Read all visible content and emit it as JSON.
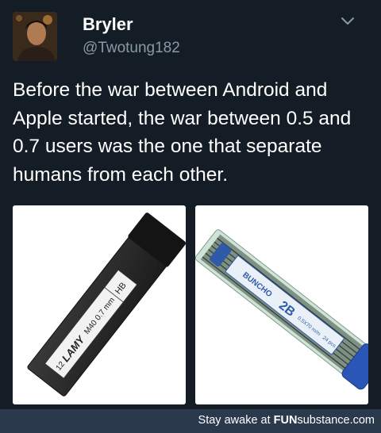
{
  "tweet": {
    "display_name": "Bryler",
    "handle": "@Twotung182",
    "text": "Before the war between Android and Apple started, the war between 0.5 and 0.7 users was the one that separate humans from each other."
  },
  "images": [
    {
      "brand": "LAMY",
      "count": "12",
      "model": "M40 0.7 mm",
      "grade": "HB"
    },
    {
      "brand": "BUNCHO",
      "grade": "2B",
      "spec": "0.5X70 m/m",
      "count": "24 pcs"
    }
  ],
  "footer": {
    "prefix": "Stay awake at ",
    "brand_bold": "FUN",
    "brand_rest": "substance",
    "suffix": ".com"
  },
  "icons": {
    "menu": "chevron-down-icon"
  }
}
